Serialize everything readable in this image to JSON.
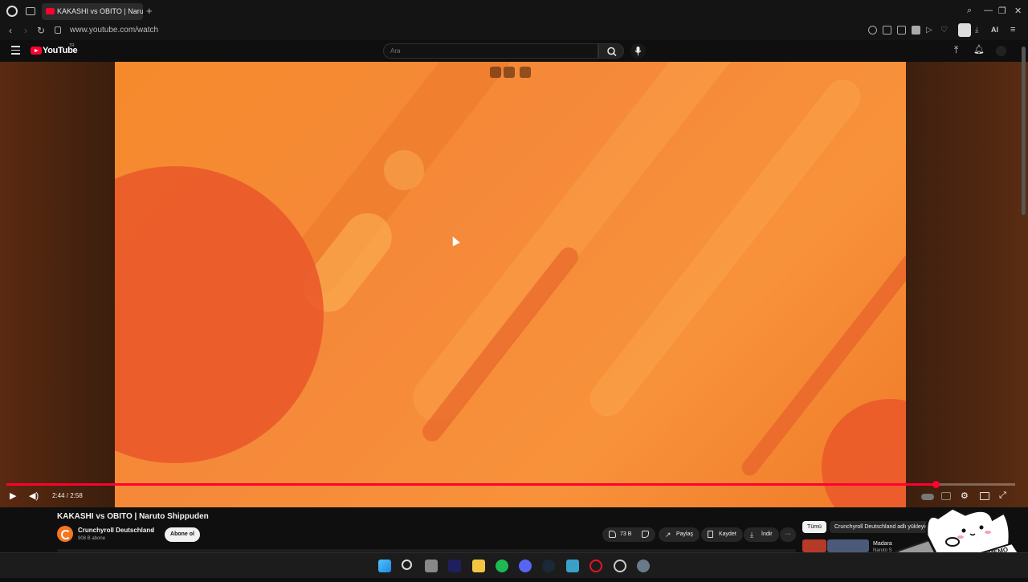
{
  "browser": {
    "tab_title": "KAKASHI vs OBITO | Naruto Shippuden",
    "new_tab_icon": "plus-icon",
    "url": "www.youtube.com/watch",
    "ai_label": "AI"
  },
  "youtube": {
    "logo_text": "YouTube",
    "country_code": "TR",
    "search_placeholder": "Ara"
  },
  "player": {
    "current_time": "2:44",
    "duration": "2:58",
    "time_display": "2:44 / 2:58",
    "progress_fraction": 0.921,
    "accent_color": "#ff0033"
  },
  "video": {
    "title": "KAKASHI vs OBITO | Naruto Shippuden",
    "channel_name": "Crunchyroll Deutschland",
    "subscribers": "908 B abone",
    "subscribe_label": "Abone ol",
    "like_count": "73 B",
    "share_label": "Paylaş",
    "save_label": "Kaydet",
    "download_label": "İndir",
    "more_label": "···"
  },
  "related": {
    "chips": [
      "Tümü",
      "Crunchyroll Deutschland adlı yükleyici"
    ],
    "first_title": "Madara",
    "first_sub": "Naruto S"
  },
  "sticker": {
    "text": "OBSY MEMO"
  }
}
